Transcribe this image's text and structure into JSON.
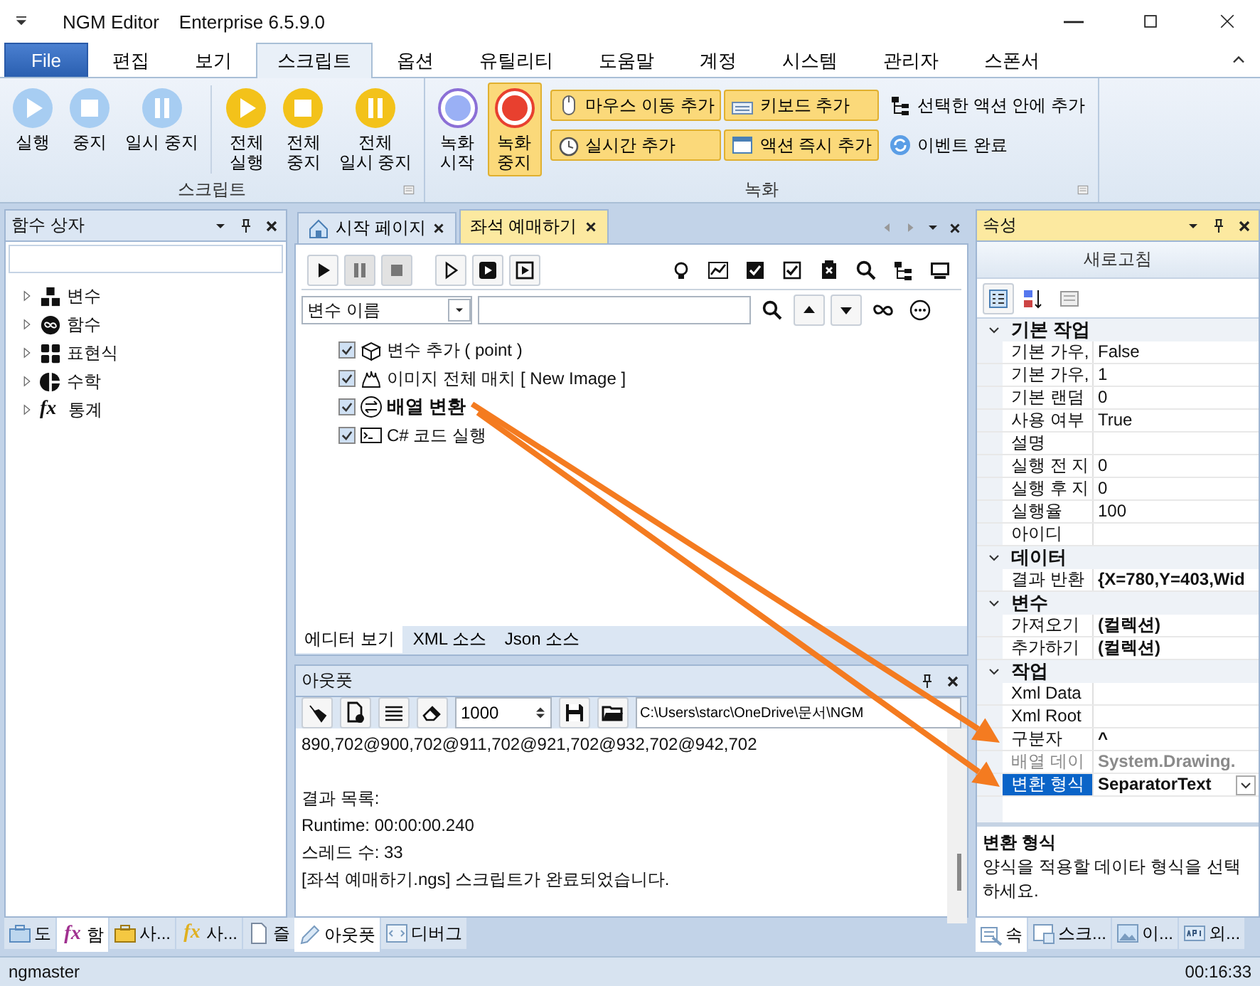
{
  "window": {
    "title": "NGM Editor",
    "edition": "Enterprise 6.5.9.0"
  },
  "menu_tabs": [
    {
      "label": "File",
      "kind": "file",
      "selected": false
    },
    {
      "label": "편집",
      "kind": "tab",
      "selected": false
    },
    {
      "label": "보기",
      "kind": "tab",
      "selected": false
    },
    {
      "label": "스크립트",
      "kind": "tab",
      "selected": true
    },
    {
      "label": "옵션",
      "kind": "tab",
      "selected": false
    },
    {
      "label": "유틸리티",
      "kind": "tab",
      "selected": false
    },
    {
      "label": "도움말",
      "kind": "tab",
      "selected": false
    },
    {
      "label": "계정",
      "kind": "tab",
      "selected": false
    },
    {
      "label": "시스템",
      "kind": "tab",
      "selected": false
    },
    {
      "label": "관리자",
      "kind": "tab",
      "selected": false
    },
    {
      "label": "스폰서",
      "kind": "tab",
      "selected": false
    }
  ],
  "ribbon": {
    "groups": [
      {
        "label": "스크립트",
        "large_buttons": [
          {
            "label": "실행",
            "kind": "play",
            "color": "#a7cdf2",
            "active": false
          },
          {
            "label": "중지",
            "kind": "stop",
            "color": "#a7cdf2",
            "active": false
          },
          {
            "label": "일시 중지",
            "kind": "pause",
            "color": "#a7cdf2",
            "active": false
          },
          {
            "label": "전체\n실행",
            "kind": "play",
            "color": "#f3c21a",
            "active": false
          },
          {
            "label": "전체\n중지",
            "kind": "stop",
            "color": "#f3c21a",
            "active": false
          },
          {
            "label": "전체\n일시 중지",
            "kind": "pause",
            "color": "#f3c21a",
            "active": false
          }
        ]
      },
      {
        "label": "녹화",
        "large_buttons": [
          {
            "label": "녹화\n시작",
            "kind": "record-start",
            "color": "#8b6fd6",
            "active": false
          },
          {
            "label": "녹화\n중지",
            "kind": "record",
            "color": "#e8402f",
            "active": true
          }
        ],
        "small_buttons": [
          {
            "label": "마우스 이동 추가",
            "kind": "mouse",
            "active": true
          },
          {
            "label": "키보드 추가",
            "kind": "keyboard",
            "active": true
          },
          {
            "label": "선택한 액션 안에 추가",
            "kind": "tree",
            "active": false
          },
          {
            "label": "실시간 추가",
            "kind": "clock",
            "active": true
          },
          {
            "label": "액션 즉시 추가",
            "kind": "window",
            "active": true
          },
          {
            "label": "이벤트 완료",
            "kind": "refresh",
            "active": false
          }
        ]
      }
    ]
  },
  "function_box": {
    "title": "함수 상자",
    "items": [
      {
        "label": "변수",
        "kind": "blocks",
        "expanded": false
      },
      {
        "label": "함수",
        "kind": "infinity",
        "expanded": false
      },
      {
        "label": "표현식",
        "kind": "calc",
        "expanded": false
      },
      {
        "label": "수학",
        "kind": "pie",
        "expanded": false
      },
      {
        "label": "통계",
        "kind": "symbol",
        "symbol": "fx",
        "expanded": false
      }
    ],
    "tabs": [
      {
        "label": "도",
        "kind": "toolbox",
        "selected": false
      },
      {
        "label": "함",
        "kind": "symbol",
        "symbol": "fx",
        "color": "#a03090",
        "selected": true
      },
      {
        "label": "사...",
        "kind": "toolbox",
        "selected": false
      },
      {
        "label": "사...",
        "kind": "symbol",
        "symbol": "fx",
        "color": "#e0b020",
        "selected": false
      },
      {
        "label": "즐",
        "kind": "doc",
        "selected": false
      }
    ]
  },
  "editor": {
    "doc_tabs": [
      {
        "label": "시작 페이지",
        "kind": "home",
        "selected": false
      },
      {
        "label": "좌석 예매하기",
        "kind": "doc",
        "selected": true
      }
    ],
    "filter": {
      "value": "변수 이름"
    },
    "actions": [
      {
        "label": "변수 추가 ( point )",
        "kind": "box",
        "checked": true,
        "selected": false
      },
      {
        "label": "이미지 전체 매치 [ New  Image ]",
        "kind": "image",
        "checked": true,
        "selected": false
      },
      {
        "label": "배열 변환",
        "kind": "swap",
        "checked": true,
        "selected": true
      },
      {
        "label": "C# 코드 실행",
        "kind": "console",
        "checked": true,
        "selected": false
      }
    ],
    "view_tabs": [
      {
        "label": "에디터 보기",
        "selected": true
      },
      {
        "label": "XML 소스",
        "selected": false
      },
      {
        "label": "Json 소스",
        "selected": false
      }
    ]
  },
  "output": {
    "title": "아웃풋",
    "count": "1000",
    "path": "C:\\Users\\starc\\OneDrive\\문서\\NGM",
    "blocks": [
      [
        "890,702@900,702@911,702@921,702@932,702@942,702"
      ],
      [
        "결과 목록:",
        "Runtime: 00:00:00.240",
        "스레드 수: 33",
        "[좌석 예매하기.ngs] 스크립트가 완료되었습니다."
      ]
    ],
    "tabs": [
      {
        "label": "아웃풋",
        "kind": "pencil",
        "selected": true
      },
      {
        "label": "디버그",
        "kind": "code",
        "selected": false
      }
    ]
  },
  "properties": {
    "title": "속성",
    "refresh": "새로고침",
    "categories": [
      {
        "label": "기본 작업",
        "expanded": true,
        "rows": [
          {
            "name": "기본 가우,",
            "value": "False",
            "bold": false,
            "disabled": false,
            "selected": false
          },
          {
            "name": "기본 가우,",
            "value": "1",
            "bold": false,
            "disabled": false,
            "selected": false
          },
          {
            "name": "기본 랜덤",
            "value": "0",
            "bold": false,
            "disabled": false,
            "selected": false
          },
          {
            "name": "사용 여부",
            "value": "True",
            "bold": false,
            "disabled": false,
            "selected": false
          },
          {
            "name": "설명",
            "disabled": false,
            "selected": false
          },
          {
            "name": "실행 전 지",
            "value": "0",
            "bold": false,
            "disabled": false,
            "selected": false
          },
          {
            "name": "실행 후 지",
            "value": "0",
            "bold": false,
            "disabled": false,
            "selected": false
          },
          {
            "name": "실행율",
            "value": "100",
            "bold": false,
            "disabled": false,
            "selected": false
          },
          {
            "name": "아이디",
            "disabled": false,
            "selected": false
          }
        ]
      },
      {
        "label": "데이터",
        "expanded": true,
        "rows": [
          {
            "name": "결과 반환",
            "value": "{X=780,Y=403,Wid",
            "bold": true,
            "disabled": false,
            "selected": false
          }
        ]
      },
      {
        "label": "변수",
        "expanded": true,
        "rows": [
          {
            "name": "가져오기",
            "value": "(컬렉션)",
            "bold": true,
            "disabled": false,
            "selected": false
          },
          {
            "name": "추가하기",
            "value": "(컬렉션)",
            "bold": true,
            "disabled": false,
            "selected": false
          }
        ]
      },
      {
        "label": "작업",
        "expanded": true,
        "rows": [
          {
            "name": "Xml Data",
            "disabled": false,
            "selected": false
          },
          {
            "name": "Xml Root",
            "disabled": false,
            "selected": false
          },
          {
            "name": "구분자",
            "value": "^",
            "bold": true,
            "disabled": false,
            "selected": false
          },
          {
            "name": "배열 데이",
            "value": "System.Drawing.",
            "bold": true,
            "disabled": true,
            "selected": false
          },
          {
            "name": "변환 형식",
            "value": "SeparatorText",
            "bold": true,
            "disabled": false,
            "selected": true
          }
        ]
      }
    ],
    "description": {
      "title": "변환 형식",
      "text": "양식을 적용할 데이타 형식을 선택하세요."
    },
    "tabs": [
      {
        "label": "속",
        "kind": "props",
        "selected": true
      },
      {
        "label": "스크...",
        "kind": "script",
        "selected": false
      },
      {
        "label": "이...",
        "kind": "image",
        "selected": false
      },
      {
        "label": "외...",
        "kind": "api",
        "selected": false
      }
    ]
  },
  "status_bar": {
    "user": "ngmaster",
    "time": "00:16:33"
  },
  "annotations": [
    {
      "kind": "arrow"
    },
    {
      "kind": "arrow"
    }
  ]
}
